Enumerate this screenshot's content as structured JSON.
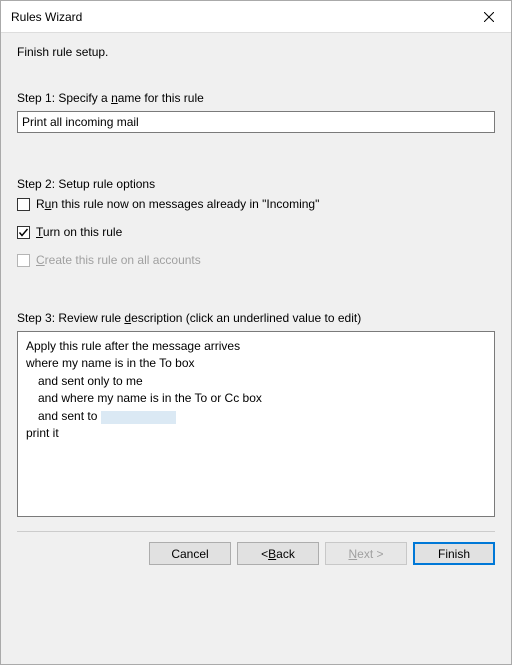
{
  "window": {
    "title": "Rules Wizard"
  },
  "heading": "Finish rule setup.",
  "step1": {
    "label_pre": "Step 1: Specify a ",
    "label_u": "n",
    "label_post": "ame for this rule",
    "value": "Print all incoming mail"
  },
  "step2": {
    "label": "Step 2: Setup rule options",
    "opt_run": {
      "checked": false,
      "pre": "R",
      "u": "u",
      "post": "n this rule now on messages already in \"Incoming\""
    },
    "opt_turnon": {
      "checked": true,
      "u": "T",
      "post": "urn on this rule"
    },
    "opt_allaccounts": {
      "disabled": true,
      "u": "C",
      "post": "reate this rule on all accounts"
    }
  },
  "step3": {
    "label_pre": "Step 3: Review rule ",
    "label_u": "d",
    "label_post": "escription (click an underlined value to edit)",
    "line1": "Apply this rule after the message arrives",
    "line2": "where my name is in the To box",
    "line3": "and sent only to me",
    "line4": "and where my name is in the To or Cc box",
    "line5_pre": "and sent to ",
    "line6": "print it"
  },
  "buttons": {
    "cancel": "Cancel",
    "back_pre": "< ",
    "back_u": "B",
    "back_post": "ack",
    "next_u": "N",
    "next_post": "ext >",
    "finish": "Finish"
  }
}
